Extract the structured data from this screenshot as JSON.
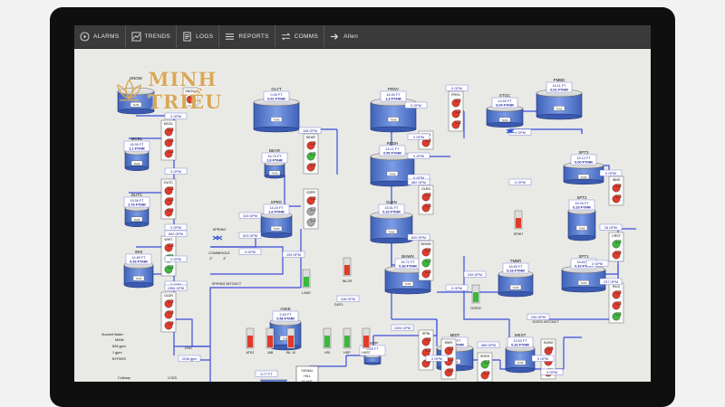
{
  "toolbar": {
    "items": [
      {
        "label": "ALARMS",
        "icon": "play-circle-icon"
      },
      {
        "label": "TRENDS",
        "icon": "trend-chart-icon"
      },
      {
        "label": "LOGS",
        "icon": "document-icon"
      },
      {
        "label": "REPORTS",
        "icon": "list-icon"
      },
      {
        "label": "COMMS",
        "icon": "arrows-icon"
      },
      {
        "label": "Allen",
        "icon": "arrow-right-icon"
      }
    ]
  },
  "logo": {
    "text": "MINH TRIỀU"
  },
  "colors": {
    "pump_red": "#e23a2a",
    "pump_green": "#3cb83c",
    "pump_gray": "#a8a8a8",
    "tank": "#5b7fcf",
    "pipe": "#3b4fd8",
    "valve": "#2f56d6"
  },
  "tanks": [
    {
      "id": "snow",
      "name": "SNOW",
      "level": "",
      "flow": "0 GPM",
      "label": "TANK"
    },
    {
      "id": "mcdl",
      "name": "MCDL",
      "level": "16.90 FT",
      "flow": "1.1 FT/HR",
      "label": "TANK"
    },
    {
      "id": "dutc",
      "name": "DUTC",
      "level": "15.58 FT",
      "flow": "2.76 FT/HR",
      "label": "TANK"
    },
    {
      "id": "whi",
      "name": "WHI",
      "level": "14.89 FT",
      "flow": "0.52 FT/HR",
      "label": "TANK"
    },
    {
      "id": "glyt",
      "name": "GLYT",
      "level": "0.00 FT",
      "flow": "0.01 FT/HR",
      "label": "TANK"
    },
    {
      "id": "bear",
      "name": "BEAR",
      "level": "16.70 FT",
      "flow": "1.8 FT/HR",
      "label": "TANK"
    },
    {
      "id": "sprg",
      "name": "SPRG",
      "level": "14.24 FT",
      "flow": "1.6 FT/HR",
      "label": "TANK"
    },
    {
      "id": "prsv",
      "name": "PRSV",
      "level": "16.90 FT",
      "flow": "1.3 FT/HR",
      "label": "TANK"
    },
    {
      "id": "redh",
      "name": "REDH",
      "level": "16.11 FT",
      "flow": "0.50 FT/HR",
      "label": "TANK"
    },
    {
      "id": "glen",
      "name": "GLEN",
      "level": "15.51 FT",
      "flow": "0.10 FT/HR",
      "label": "TANK"
    },
    {
      "id": "bhwn",
      "name": "BHWN",
      "level": "16.71 FT",
      "flow": "0.36 FT/HR",
      "label": "TANK"
    },
    {
      "id": "stgc",
      "name": "STGC",
      "level": "13.50 FT",
      "flow": "0.04 FT/HR",
      "label": "TANK"
    },
    {
      "id": "pmbd",
      "name": "PMBD",
      "level": "16.11 FT",
      "flow": "0.01 FT/HR",
      "label": "TANK"
    },
    {
      "id": "spt3",
      "name": "SPT3",
      "level": "15.12 FT",
      "flow": "0.00 FT/HR",
      "label": "TANK"
    },
    {
      "id": "spt2",
      "name": "SPT2",
      "level": "16.93 FT",
      "flow": "0.29 FT/HR",
      "label": "TANK"
    },
    {
      "id": "spt1",
      "name": "SPT1",
      "level": "16.83 FT",
      "flow": "0.10 FT/HR",
      "label": "TANK"
    },
    {
      "id": "tmbr",
      "name": "TMBR",
      "level": "16.69 FT",
      "flow": "0.16 FT/HR",
      "label": "TANK"
    },
    {
      "id": "aske",
      "name": "ASKE",
      "level": "2.63 FT",
      "flow": "0.56 FT/HR",
      "label": "TANK"
    },
    {
      "id": "midt",
      "name": "MIDT",
      "level": "5.08 FT",
      "flow": "0.04 FT/HR",
      "label": "TANK"
    },
    {
      "id": "west",
      "name": "WEST",
      "level": "13.53 FT",
      "flow": "0.32 FT/HR",
      "label": "TANK"
    },
    {
      "id": "shtp",
      "name": "SHTP",
      "level": "0.25 FT",
      "flow": "",
      "label": ""
    }
  ],
  "stations": {
    "mcdl": "MCDL",
    "dutc": "DUTC",
    "whit": "WHIT",
    "oldr": "OLDR",
    "bear": "BEAR",
    "sspr": "SSPR",
    "prsv": "PRSV",
    "redh": "REDH",
    "glen": "GLEN",
    "bhwn": "BHWN",
    "inns": "INNS",
    "crst": "CRST",
    "rild": "RILD",
    "spin": "SPIN",
    "mwv": "MWV",
    "shds": "SHDS",
    "sumo": "SUMO",
    "snow": "SNOW"
  },
  "flows": {
    "f1": "0 GPM",
    "f2": "0 GPM",
    "f3": "108 GPM",
    "f4": "0 GPM",
    "f5": "0 GPM",
    "f6": "692 GPM",
    "f7": "0 GPM",
    "f8": "1996 GPM",
    "f9": "103 GPM",
    "f10": "623 GPM",
    "f11": "0 GPM",
    "f12": "193 GPM",
    "f13": "0 GPM",
    "f14": "0 GPM",
    "f15": "0 GPM",
    "f16": "0 GPM",
    "f17": "682 GPM",
    "f18": "620 GPM",
    "f19": "0 GPM",
    "f20": "0 GPM",
    "f21": "0 GPM",
    "f22": "0 GPM",
    "f23": "26 GPM",
    "f24": "0 GPM",
    "f25": "237 GPM",
    "f26": "249 GPM",
    "f27": "0 GPM",
    "f28": "230 GPM",
    "f29": "418 GPM",
    "f30": "1094 GPM",
    "f31": "0 GPM",
    "f32": "589 GPM",
    "f33": "0 GPM",
    "f34": "0 GPM",
    "f35": "2246 gpm",
    "f36": "0 GPM",
    "f37": "6.77 FT",
    "f38": "2056 GPM",
    "f39": "0 GPM",
    "f40": "428 GPM",
    "f41": "467 GPM"
  },
  "labels": {
    "spring": "SPRING",
    "commingle": "COMMINGLE",
    "c2": "2\"",
    "c4": "4\"",
    "spring_intcnct": "SPRING INTCNCT",
    "lake": "LAKE",
    "wl2r": "WL2R",
    "dufl": "DUFL",
    "gorg": "GORG",
    "gorg_intcnct": "GORG INTCNCT",
    "spw7": "SPW7",
    "summit": "Summit Water",
    "main": "MAIN",
    "main_gpm": "826 gpm",
    "bypass_gpm": "1 gpm",
    "bypass": "BYPASS",
    "dvd": "DVD",
    "culinary": "Culinary",
    "lcds": "LCDS",
    "atk2": "ATK2",
    "jab": "JAB",
    "wl10": "WL 10",
    "hsi": "HSI",
    "hsp": "HSP",
    "hust": "HUST",
    "signal_hill": "SIGNAL",
    "signal_hill2": "HILL",
    "plant": "PLANT",
    "park_city": "PARK CITY",
    "nicklaus": "NICKLAUS",
    "mtn_grdn": "MTN GRDN",
    "pond2": "POND2"
  }
}
